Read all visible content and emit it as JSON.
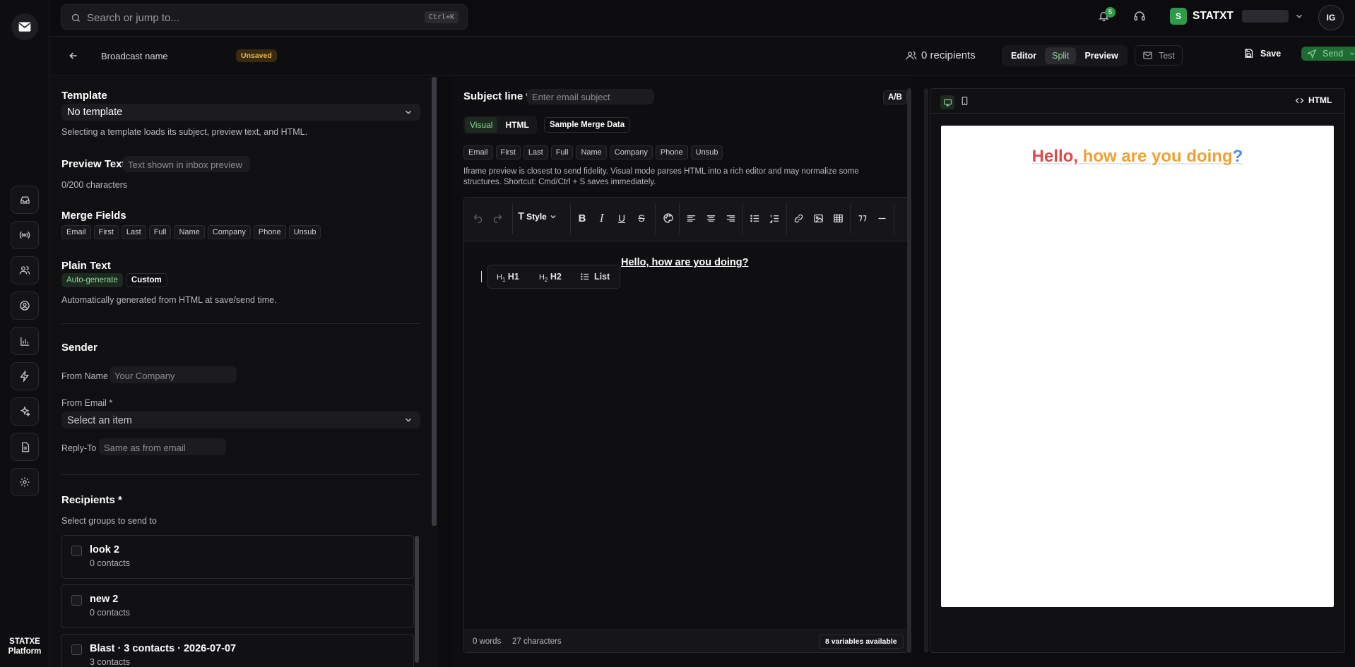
{
  "app": {
    "footer_line1": "STATXE",
    "footer_line2": "Platform"
  },
  "topbar": {
    "search_placeholder": "Search or jump to...",
    "search_shortcut": "Ctrl+K",
    "notification_count": "5",
    "workspace_initial": "S",
    "workspace_name": "STATXT",
    "user_initials": "IG"
  },
  "header": {
    "broadcast_name": "Broadcast name",
    "status_badge": "Unsaved",
    "recipients": "0 recipients",
    "modes": [
      "Editor",
      "Split",
      "Preview"
    ],
    "active_mode": "Split",
    "test_label": "Test",
    "save_label": "Save",
    "send_label": "Send"
  },
  "left": {
    "template_label": "Template",
    "template_value": "No template",
    "template_help": "Selecting a template loads its subject, preview text, and HTML.",
    "preview_text_label": "Preview Text",
    "preview_text_placeholder": "Text shown in inbox preview",
    "preview_count": "0/200 characters",
    "merge_fields_label": "Merge Fields",
    "merge_fields": [
      "Email",
      "First",
      "Last",
      "Full",
      "Name",
      "Company",
      "Phone",
      "Unsub"
    ],
    "plain_text_label": "Plain Text",
    "plain_modes": [
      "Auto-generate",
      "Custom"
    ],
    "plain_help": "Automatically generated from HTML at save/send time.",
    "sender_label": "Sender",
    "from_name_label": "From Name",
    "from_name_placeholder": "Your Company",
    "from_email_label": "From Email *",
    "from_email_placeholder": "Select an item",
    "reply_to_label": "Reply-To",
    "reply_to_placeholder": "Same as from email",
    "recipients_label": "Recipients *",
    "recipients_help": "Select groups to send to",
    "groups": [
      {
        "name": "look 2",
        "count": "0 contacts"
      },
      {
        "name": "new 2",
        "count": "0 contacts"
      },
      {
        "name": "Blast · 3 contacts · 2026-07-07",
        "count": "3 contacts"
      }
    ]
  },
  "editor": {
    "subject_label": "Subject line *",
    "subject_placeholder": "Enter email subject",
    "ab_label": "A/B",
    "view_tabs": [
      "Visual",
      "HTML"
    ],
    "active_view": "Visual",
    "sample_merge": "Sample Merge Data",
    "merge_fields": [
      "Email",
      "First",
      "Last",
      "Full",
      "Name",
      "Company",
      "Phone",
      "Unsub"
    ],
    "note": "Iframe preview is closest to send fidelity. Visual mode parses HTML into a rich editor and may normalize some structures. Shortcut: Cmd/Ctrl + S saves immediately.",
    "style_label": "Style",
    "content_text": "Hello, how are you doing?",
    "popup_h1": "H1",
    "popup_h2": "H2",
    "popup_list": "List",
    "word_count": "0 words",
    "char_count": "27 characters",
    "variables": "8 variables available"
  },
  "preview": {
    "html_label": "HTML",
    "greeting_part1": "Hello,",
    "greeting_part2": " how are you doing",
    "greeting_part3": "?",
    "colors": {
      "part1": "#e04848",
      "part2": "#f0a030",
      "part3": "#4a90e2"
    }
  },
  "colors": {
    "accent_green": "#2e9a4a",
    "send_green": "#1f6b33"
  }
}
